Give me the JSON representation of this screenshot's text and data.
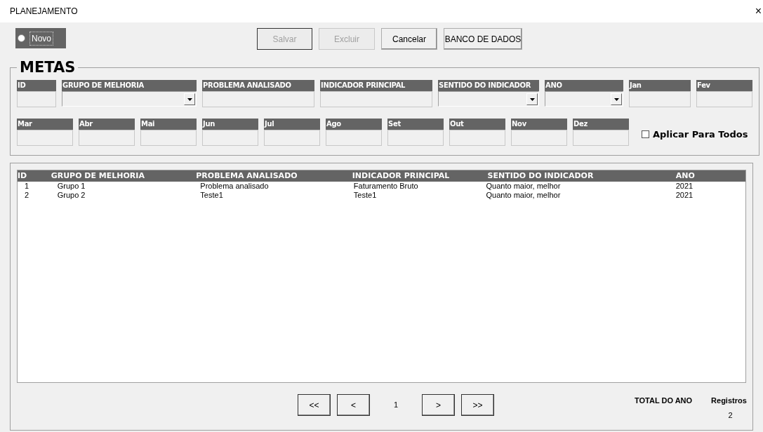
{
  "window": {
    "title": "PLANEJAMENTO",
    "close": "×"
  },
  "novo": {
    "label": "Novo",
    "selected": false
  },
  "buttons": [
    {
      "label": "Salvar",
      "disabled": true
    },
    {
      "label": "Excluir",
      "disabled": true
    },
    {
      "label": "Cancelar",
      "disabled": false
    },
    {
      "label": "BANCO DE DADOS",
      "disabled": false
    }
  ],
  "metas": {
    "title": "METAS",
    "fields": [
      {
        "label": "ID",
        "kind": "text"
      },
      {
        "label": "GRUPO DE MELHORIA",
        "kind": "combo"
      },
      {
        "label": "PROBLEMA ANALISADO",
        "kind": "text"
      },
      {
        "label": "INDICADOR PRINCIPAL",
        "kind": "text"
      },
      {
        "label": "SENTIDO DO INDICADOR",
        "kind": "combo"
      },
      {
        "label": "ANO",
        "kind": "combo"
      },
      {
        "label": "Jan",
        "kind": "text"
      },
      {
        "label": "Fev",
        "kind": "text"
      }
    ],
    "months": [
      {
        "label": "Mar"
      },
      {
        "label": "Abr"
      },
      {
        "label": "Mai"
      },
      {
        "label": "Jun"
      },
      {
        "label": "Jul"
      },
      {
        "label": "Ago"
      },
      {
        "label": "Set"
      },
      {
        "label": "Out"
      },
      {
        "label": "Nov"
      },
      {
        "label": "Dez"
      }
    ],
    "apply_all": {
      "label": "Aplicar Para Todos",
      "checked": false
    }
  },
  "table": {
    "columns": [
      "ID",
      "GRUPO DE MELHORIA",
      "PROBLEMA ANALISADO",
      "INDICADOR PRINCIPAL",
      "SENTIDO DO INDICADOR",
      "ANO"
    ],
    "rows": [
      [
        "1",
        "Grupo 1",
        "Problema analisado",
        "Faturamento Bruto",
        "Quanto maior, melhor",
        "2021"
      ],
      [
        "2",
        "Grupo 2",
        "Teste1",
        "Teste1",
        "Quanto maior, melhor",
        "2021"
      ]
    ]
  },
  "pager": {
    "buttons": [
      "<<",
      "<"
    ],
    "page": "1",
    "buttons_after": [
      ">",
      ">>"
    ]
  },
  "footer": {
    "total_label": "TOTAL DO ANO",
    "records_label": "Registros",
    "records": "2"
  }
}
